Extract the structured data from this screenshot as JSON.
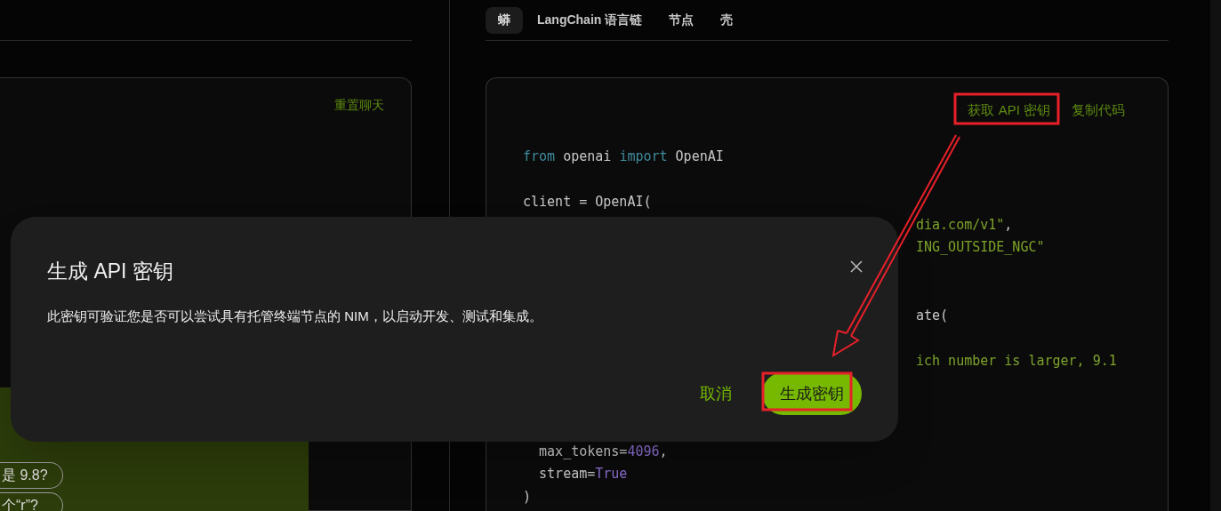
{
  "tabs": [
    {
      "label": "蟒",
      "selected": true
    },
    {
      "label": "LangChain 语言链",
      "selected": false
    },
    {
      "label": "节点",
      "selected": false
    },
    {
      "label": "壳",
      "selected": false
    }
  ],
  "chat_panel": {
    "reset_link": "重置聊天",
    "suggestions": [
      "是 9.8?",
      "个“r”?"
    ]
  },
  "code_panel": {
    "links": [
      "获取 API 密钥",
      "复制代码"
    ],
    "lines": [
      {
        "kind": "full",
        "tokens": [
          {
            "t": "from",
            "kind": "keyword"
          },
          {
            "t": " openai ",
            "kind": "plain"
          },
          {
            "t": "import",
            "kind": "keyword"
          },
          {
            "t": " OpenAI",
            "kind": "plain"
          }
        ]
      },
      {
        "kind": "blank"
      },
      {
        "kind": "full",
        "tokens": [
          {
            "t": "client = OpenAI(",
            "kind": "plain"
          }
        ]
      },
      {
        "kind": "partial",
        "tokens": [
          {
            "t": "dia.com/v1\"",
            "kind": "string"
          },
          {
            "t": ",",
            "kind": "plain"
          }
        ]
      },
      {
        "kind": "partial",
        "tokens": [
          {
            "t": "ING_OUTSIDE_NGC\"",
            "kind": "string"
          }
        ]
      },
      {
        "kind": "blank"
      },
      {
        "kind": "blank"
      },
      {
        "kind": "partial",
        "tokens": [
          {
            "t": "ate(",
            "kind": "plain"
          }
        ]
      },
      {
        "kind": "blank"
      },
      {
        "kind": "partial",
        "tokens": [
          {
            "t": "ich number is larger, 9.1",
            "kind": "string"
          }
        ]
      },
      {
        "kind": "blank"
      },
      {
        "kind": "blank"
      },
      {
        "kind": "blank"
      },
      {
        "kind": "full",
        "tokens": [
          {
            "t": "  max_tokens=",
            "kind": "plain"
          },
          {
            "t": "4096",
            "kind": "number"
          },
          {
            "t": ",",
            "kind": "plain"
          }
        ]
      },
      {
        "kind": "full",
        "tokens": [
          {
            "t": "  stream=",
            "kind": "plain"
          },
          {
            "t": "True",
            "kind": "number"
          }
        ]
      },
      {
        "kind": "full",
        "tokens": [
          {
            "t": ")",
            "kind": "plain"
          }
        ]
      }
    ]
  },
  "dialog": {
    "title": "生成 API 密钥",
    "body": "此密钥可验证您是否可以尝试具有托管终端节点的 NIM，以启动开发、测试和集成。",
    "cancel": "取消",
    "confirm": "生成密钥"
  }
}
